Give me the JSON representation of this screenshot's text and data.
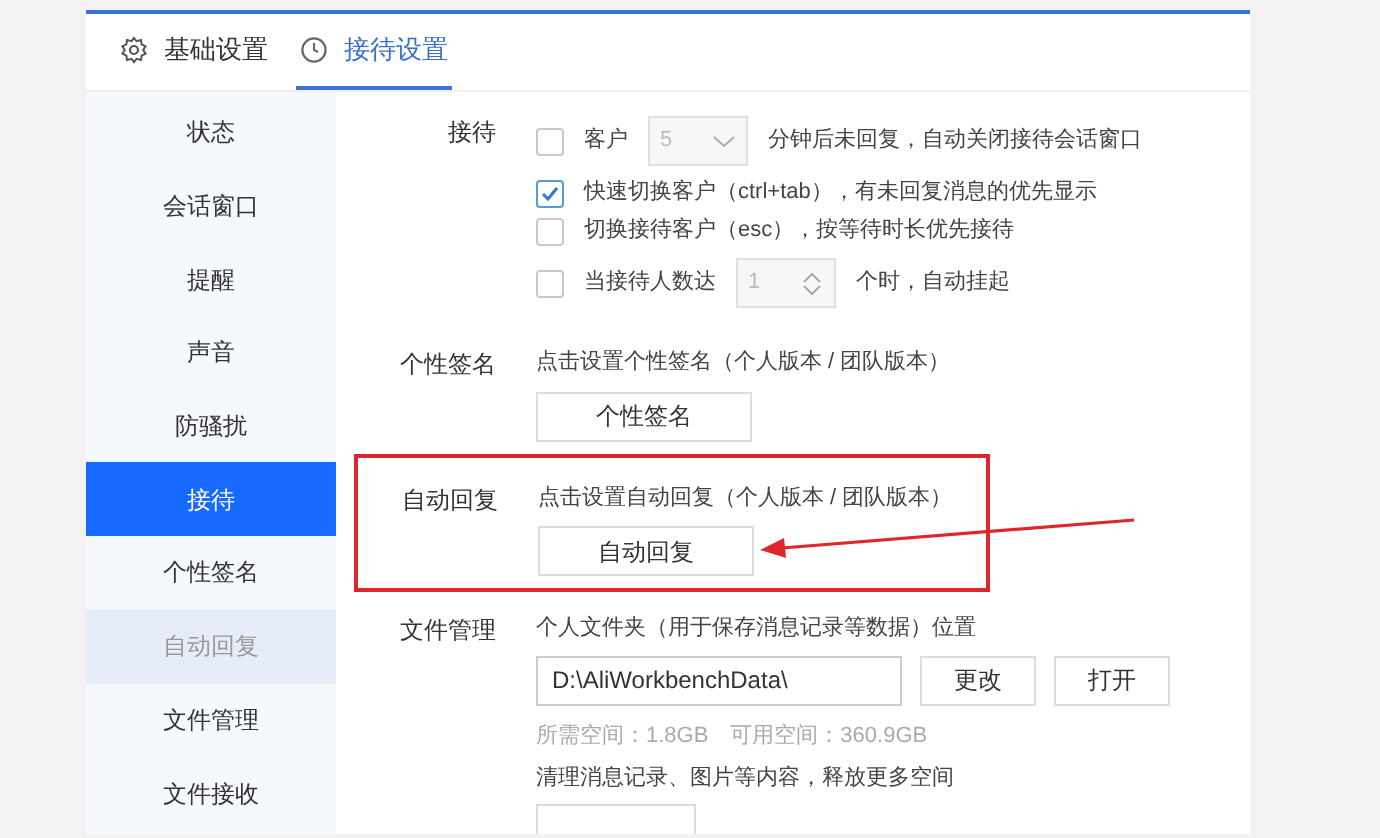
{
  "tabs": [
    {
      "label": "基础设置",
      "selected": false
    },
    {
      "label": "接待设置",
      "selected": true
    }
  ],
  "sidebar": {
    "items": [
      {
        "label": "状态",
        "selected": false,
        "hovered": false
      },
      {
        "label": "会话窗口",
        "selected": false,
        "hovered": false
      },
      {
        "label": "提醒",
        "selected": false,
        "hovered": false
      },
      {
        "label": "声音",
        "selected": false,
        "hovered": false
      },
      {
        "label": "防骚扰",
        "selected": false,
        "hovered": false
      },
      {
        "label": "接待",
        "selected": true,
        "hovered": false
      },
      {
        "label": "个性签名",
        "selected": false,
        "hovered": false
      },
      {
        "label": "自动回复",
        "selected": false,
        "hovered": true
      },
      {
        "label": "文件管理",
        "selected": false,
        "hovered": false
      },
      {
        "label": "文件接收",
        "selected": false,
        "hovered": false
      }
    ]
  },
  "reception": {
    "label": "接待",
    "options": [
      {
        "kind": "select",
        "checked": false,
        "prefix": "客户",
        "value": "5",
        "disabled": true,
        "suffix": "分钟后未回复，自动关闭接待会话窗口"
      },
      {
        "kind": "check",
        "checked": true,
        "text": "快速切换客户（ctrl+tab），有未回复消息的优先显示"
      },
      {
        "kind": "check",
        "checked": false,
        "text": "切换接待客户（esc），按等待时长优先接待"
      },
      {
        "kind": "spinner",
        "checked": false,
        "prefix": "当接待人数达",
        "value": "1",
        "disabled": true,
        "suffix": "个时，自动挂起"
      }
    ]
  },
  "signature": {
    "label": "个性签名",
    "description": "点击设置个性签名（个人版本 / 团队版本）",
    "button": "个性签名"
  },
  "auto_reply": {
    "label": "自动回复",
    "description": "点击设置自动回复（个人版本 / 团队版本）",
    "button": "自动回复",
    "highlighted": true
  },
  "file_management": {
    "label": "文件管理",
    "description": "个人文件夹（用于保存消息记录等数据）位置",
    "path": "D:\\AliWorkbenchData\\",
    "buttons": [
      "更改",
      "打开"
    ],
    "space_info": "所需空间：1.8GB　可用空间：360.9GB",
    "cleanup_text": "清理消息记录、图片等内容，释放更多空间"
  }
}
